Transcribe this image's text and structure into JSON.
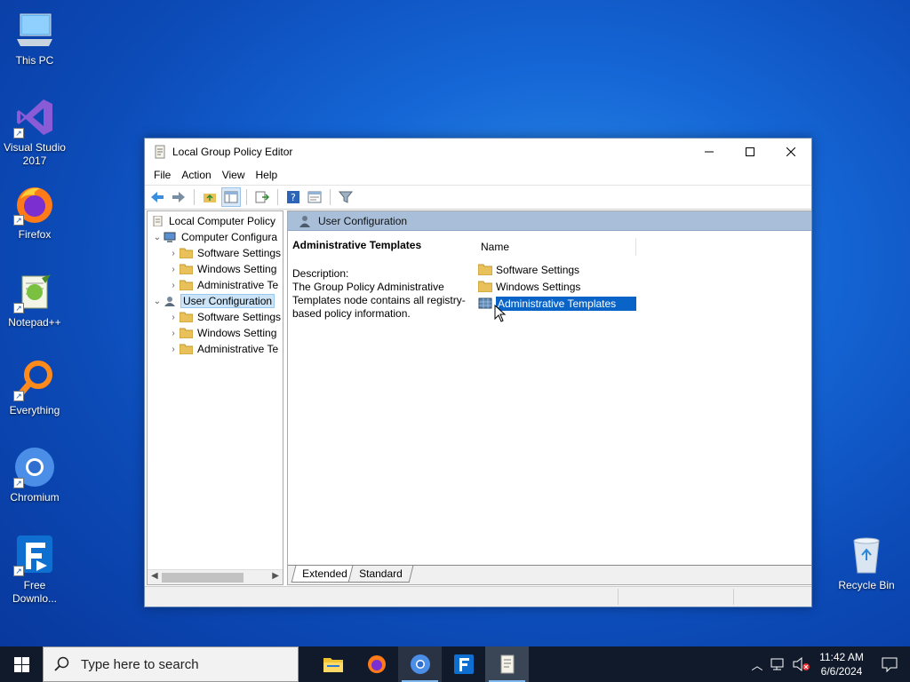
{
  "desktop": {
    "icons": [
      {
        "label": "This PC"
      },
      {
        "label": "Visual Studio 2017"
      },
      {
        "label": "Firefox"
      },
      {
        "label": "Notepad++"
      },
      {
        "label": "Everything"
      },
      {
        "label": "Chromium"
      },
      {
        "label": "Free Downlo..."
      },
      {
        "label": "Recycle Bin"
      }
    ]
  },
  "window": {
    "title": "Local Group Policy Editor",
    "menu": [
      "File",
      "Action",
      "View",
      "Help"
    ],
    "tree": {
      "root": "Local Computer Policy",
      "computer_config": "Computer Configura",
      "computer_children": [
        "Software Settings",
        "Windows Setting",
        "Administrative Te"
      ],
      "user_config": "User Configuration",
      "user_children": [
        "Software Settings",
        "Windows Setting",
        "Administrative Te"
      ]
    },
    "right_header": "User Configuration",
    "description": {
      "heading": "Administrative Templates",
      "label": "Description:",
      "text": "The Group Policy Administrative Templates node contains all registry-based policy information."
    },
    "list": {
      "column_name": "Name",
      "items": [
        "Software Settings",
        "Windows Settings",
        "Administrative Templates"
      ],
      "selected_index": 2
    },
    "tabs": [
      "Extended",
      "Standard"
    ]
  },
  "taskbar": {
    "search_placeholder": "Type here to search",
    "time": "11:42 AM",
    "date": "6/6/2024"
  },
  "colors": {
    "selection": "#0a64c8",
    "header_band": "#a9bfd9",
    "taskbar": "#101a2a"
  }
}
